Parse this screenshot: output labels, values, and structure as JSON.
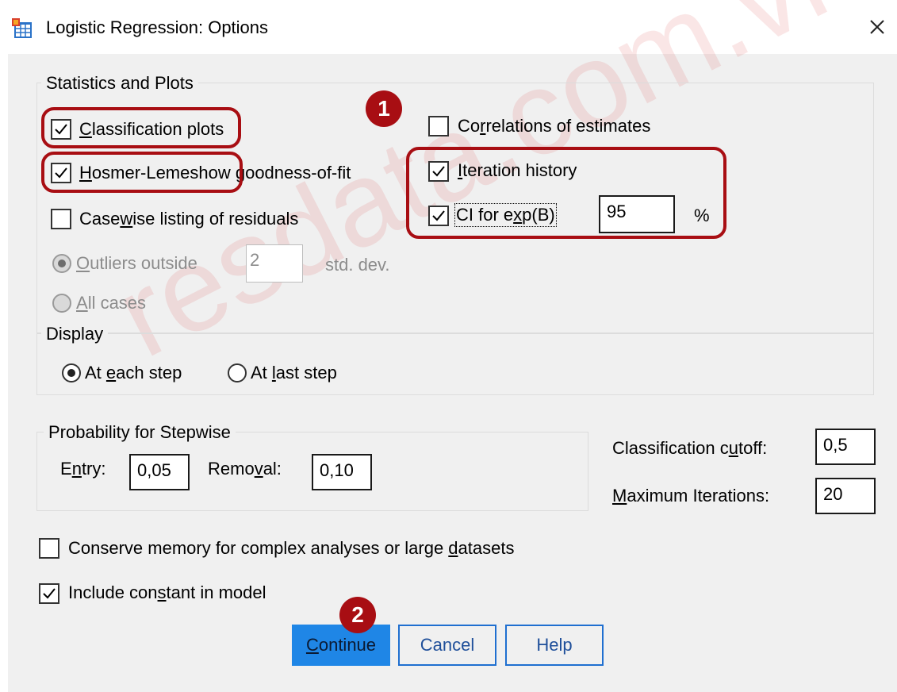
{
  "window": {
    "title": "Logistic Regression: Options",
    "app_icon": "spss-table-icon",
    "close_icon": "close-icon"
  },
  "stats_plots": {
    "legend": "Statistics and Plots",
    "classification_plots": {
      "pre": "",
      "u": "C",
      "post": "lassification plots",
      "checked": true
    },
    "hosmer_lemeshow": {
      "pre": "",
      "u": "H",
      "post": "osmer-Lemeshow goodness-of-fit",
      "checked": true
    },
    "casewise_listing": {
      "pre": "Case",
      "u": "w",
      "post": "ise listing of residuals",
      "checked": false
    },
    "outliers_outside": {
      "pre": "",
      "u": "O",
      "post": "utliers outside",
      "selected": true,
      "value": "2",
      "unit": "std. dev."
    },
    "all_cases": {
      "pre": "",
      "u": "A",
      "post": "ll cases",
      "selected": false
    },
    "correlations": {
      "pre": "Co",
      "u": "r",
      "post": "relations of estimates",
      "checked": false
    },
    "iteration_history": {
      "pre": "",
      "u": "I",
      "post": "teration history",
      "checked": true
    },
    "ci_exp_b": {
      "pre": "CI for e",
      "u": "x",
      "post": "p(B)",
      "checked": true,
      "value": "95",
      "unit": "%"
    }
  },
  "display": {
    "legend": "Display",
    "at_each_step": {
      "pre": "At ",
      "u": "e",
      "post": "ach step",
      "selected": true
    },
    "at_last_step": {
      "pre": "At ",
      "u": "l",
      "post": "ast step",
      "selected": false
    }
  },
  "stepwise": {
    "legend": "Probability for Stepwise",
    "entry": {
      "pre": "E",
      "u": "n",
      "post": "try:",
      "value": "0,05"
    },
    "removal": {
      "pre": "Remo",
      "u": "v",
      "post": "al:",
      "value": "0,10"
    }
  },
  "cutoff": {
    "pre": "Classification c",
    "u": "u",
    "post": "toff:",
    "value": "0,5"
  },
  "max_iter": {
    "pre": "",
    "u": "M",
    "post": "aximum Iterations:",
    "value": "20"
  },
  "conserve_memory": {
    "pre": "Conserve memory for complex analyses or large ",
    "u": "d",
    "post": "atasets",
    "checked": false
  },
  "include_constant": {
    "pre": "Include con",
    "u": "s",
    "post": "tant in model",
    "checked": true
  },
  "buttons": {
    "continue": {
      "pre": "",
      "u": "C",
      "post": "ontinue"
    },
    "cancel": "Cancel",
    "help": "Help"
  },
  "annotations": {
    "badge1": "1",
    "badge2": "2",
    "highlight_color": "#a80e13"
  },
  "watermark": "resdata.com.vn",
  "colors": {
    "accent": "#1f86e6",
    "dialog_bg": "#f0f0f0"
  }
}
